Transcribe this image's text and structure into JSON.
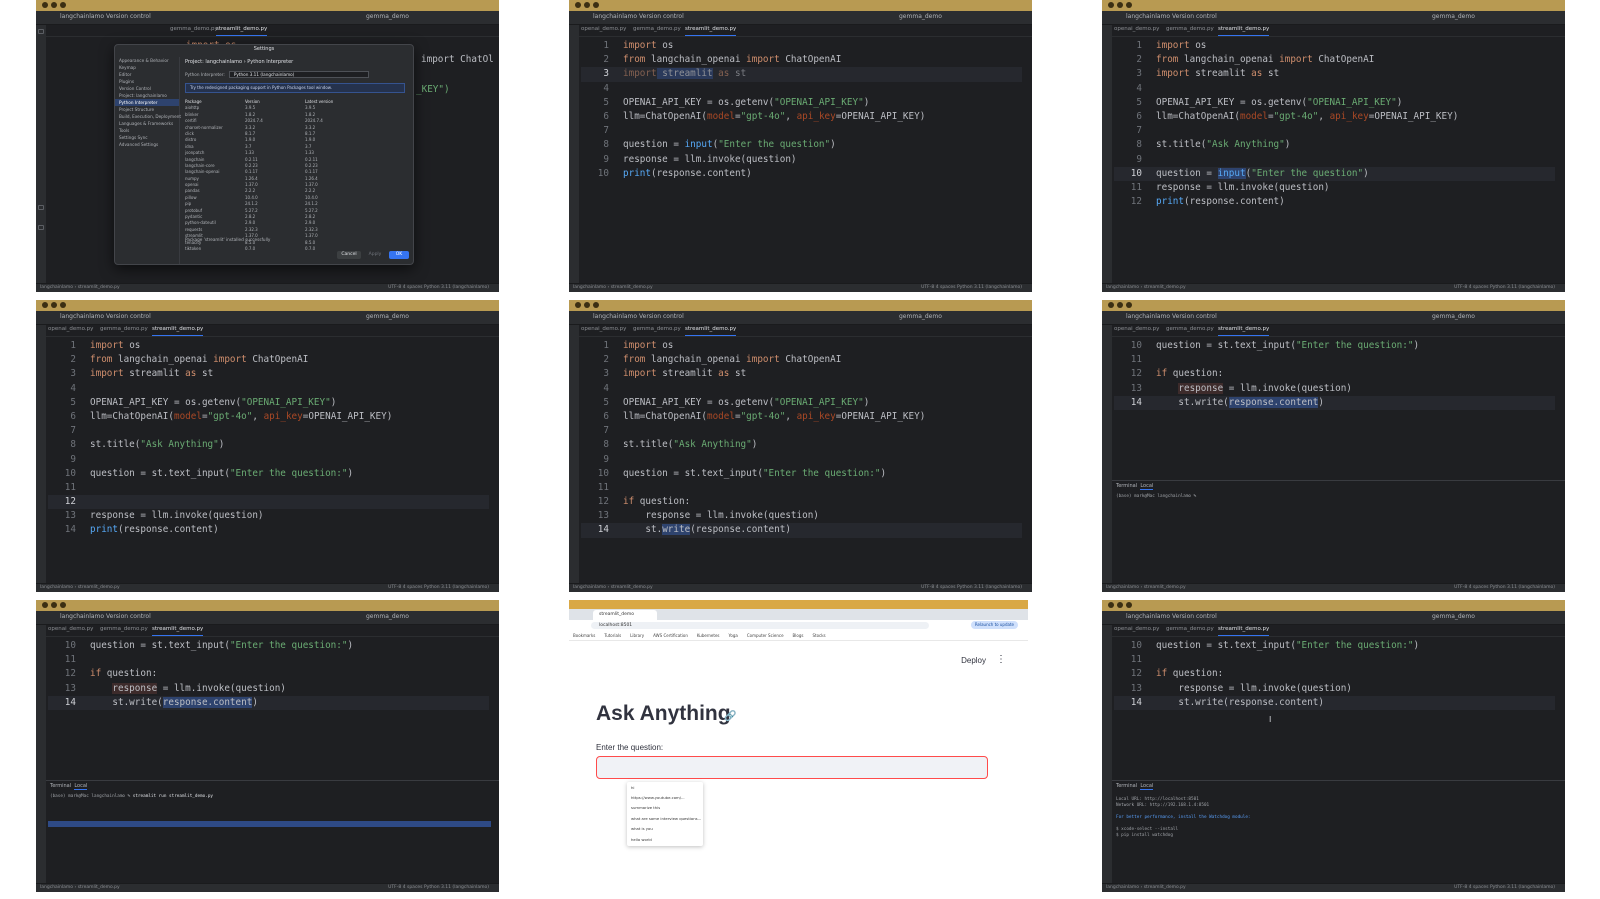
{
  "ide": {
    "project_name": "langchainlamo",
    "vcs_label": "Version control",
    "run_config": "gemma_demo",
    "tabs": [
      "openai_demo.py",
      "gemma_demo.py",
      "streamlit_demo.py"
    ],
    "status_left": "langchainlamo › streamlit_demo.py",
    "status_right": "UTF-8  4 spaces  Python 3.11 (langchainlamo)"
  },
  "dialog": {
    "title": "Settings",
    "breadcrumb": "Project: langchainlamo  ›  Python Interpreter",
    "interpreter_label": "Python Interpreter:",
    "interpreter_value": "Python 3.11 (langchainlamo)",
    "note": "Try the redesigned packaging support in Python Packages tool window.",
    "sidebar": [
      "Appearance & Behavior",
      "Keymap",
      "Editor",
      "Plugins",
      "Version Control",
      "Project: langchainlamo",
      "Python Interpreter",
      "Project Structure",
      "Build, Execution, Deployment",
      "Languages & Frameworks",
      "Tools",
      "Settings Sync",
      "Advanced Settings"
    ],
    "selected_sidebar": "Python Interpreter",
    "columns": [
      "Package",
      "Version",
      "Latest version"
    ],
    "packages": [
      [
        "aiohttp",
        "3.9.5",
        "3.9.5"
      ],
      [
        "blinker",
        "1.8.2",
        "1.8.2"
      ],
      [
        "certifi",
        "2024.7.4",
        "2024.7.4"
      ],
      [
        "charset-normalizer",
        "3.3.2",
        "3.3.2"
      ],
      [
        "click",
        "8.1.7",
        "8.1.7"
      ],
      [
        "distro",
        "1.9.0",
        "1.9.0"
      ],
      [
        "idna",
        "3.7",
        "3.7"
      ],
      [
        "jsonpatch",
        "1.33",
        "1.33"
      ],
      [
        "langchain",
        "0.2.11",
        "0.2.11"
      ],
      [
        "langchain-core",
        "0.2.23",
        "0.2.23"
      ],
      [
        "langchain-openai",
        "0.1.17",
        "0.1.17"
      ],
      [
        "numpy",
        "1.26.4",
        "1.26.4"
      ],
      [
        "openai",
        "1.37.0",
        "1.37.0"
      ],
      [
        "pandas",
        "2.2.2",
        "2.2.2"
      ],
      [
        "pillow",
        "10.4.0",
        "10.4.0"
      ],
      [
        "pip",
        "24.1.2",
        "24.1.2"
      ],
      [
        "protobuf",
        "5.27.2",
        "5.27.2"
      ],
      [
        "pydantic",
        "2.8.2",
        "2.8.2"
      ],
      [
        "python-dateutil",
        "2.9.0",
        "2.9.0"
      ],
      [
        "requests",
        "2.32.3",
        "2.32.3"
      ],
      [
        "streamlit",
        "1.37.0",
        "1.37.0"
      ],
      [
        "tenacity",
        "8.5.0",
        "8.5.0"
      ],
      [
        "tiktoken",
        "0.7.0",
        "0.7.0"
      ]
    ],
    "footer_status": "Package 'streamlit' installed successfully",
    "cancel_label": "Cancel",
    "apply_label": "Apply",
    "ok_label": "OK"
  },
  "panel1_code": {
    "line1": "import os",
    "line2": "import ChatOl",
    "line3": "_KEY\")"
  },
  "panel2_code": {
    "l1_kw": "import",
    "l1_rest": " os",
    "l2_kw1": "from",
    "l2_mid": " langchain_openai ",
    "l2_kw2": "import",
    "l2_rest": " ChatOpenAI",
    "l3_kw": "import",
    "l3_mod": " streamlit",
    "l3_kw2": " as",
    "l3_rest": " st",
    "l5_a": "OPENAI_API_KEY = os.getenv(",
    "l5_s": "\"OPENAI_API_KEY\"",
    "l5_b": ")",
    "l6_a": "llm=ChatOpenAI(",
    "l6_p1": "model",
    "l6_eq1": "=",
    "l6_s": "\"gpt-4o\"",
    "l6_c": ", ",
    "l6_p2": "api_key",
    "l6_b": "=OPENAI_API_KEY)",
    "l8_a": "question = ",
    "l8_fn": "input",
    "l8_b": "(",
    "l8_s": "\"Enter the question\"",
    "l8_c": ")",
    "l9": "response = llm.invoke(question)",
    "l10_fn": "print",
    "l10_rest": "(response.content)"
  },
  "panel3_code": {
    "l8_a": "st.title(",
    "l8_s": "\"Ask Anything\"",
    "l8_b": ")"
  },
  "panel4_code": {
    "l10_a": "question = st.text_input(",
    "l10_s": "\"Enter the question:\"",
    "l10_b": ")",
    "l13": "response = llm.invoke(question)",
    "l14_fn": "print",
    "l14_rest": "(response.content)"
  },
  "panel5_code": {
    "l12_kw": "if",
    "l12_rest": " question:",
    "l13": "    response = llm.invoke(question)",
    "l14_a": "    st.",
    "l14_fn": "write",
    "l14_b": "(response.content)"
  },
  "panel6_code": {
    "l13_a": "    ",
    "l13_var": "response",
    "l13_b": " = llm.invoke(question)",
    "l14_a": "    st.write(",
    "l14_hl": "response.content",
    "l14_b": ")"
  },
  "terminal": {
    "tab_terminal": "Terminal",
    "tab_local": "Local",
    "prompt": "(base) mark@Mac langchainlamo % ",
    "command": "streamlit run streamlit_demo.py",
    "out_local": "Local URL: http://localhost:8501",
    "out_network": "Network URL: http://192.168.1.4:8501",
    "out_perf": "For better performance, install the Watchdog module:",
    "out_cmd1": "$ xcode-select --install",
    "out_cmd2": "$ pip install watchdog"
  },
  "browser": {
    "tab_title": "streamlit_demo",
    "url": "localhost:8501",
    "relaunch": "Relaunch to update",
    "bookmarks": [
      "Bookmarks",
      "Tutorials",
      "Library",
      "AWS Certification",
      "Kubernetes",
      "Yoga",
      "Computer Science",
      "Blogs",
      "Stocks"
    ],
    "deploy": "Deploy",
    "menu": "⋮",
    "title": "Ask Anything",
    "link_icon": "🔗",
    "input_label": "Enter the question:",
    "suggestions": [
      "hi",
      "https://www.youtube.com/...",
      "summarize this",
      "what are some interview questions...",
      "what is you",
      "hello world"
    ]
  },
  "colors": {
    "editor_bg": "#1e1f22",
    "keyword": "#cf8e6d",
    "string": "#6aab73",
    "param": "#aa4926",
    "function": "#56a8f5",
    "accent": "#3574f0",
    "streamlit_red": "#ff4b4b"
  }
}
